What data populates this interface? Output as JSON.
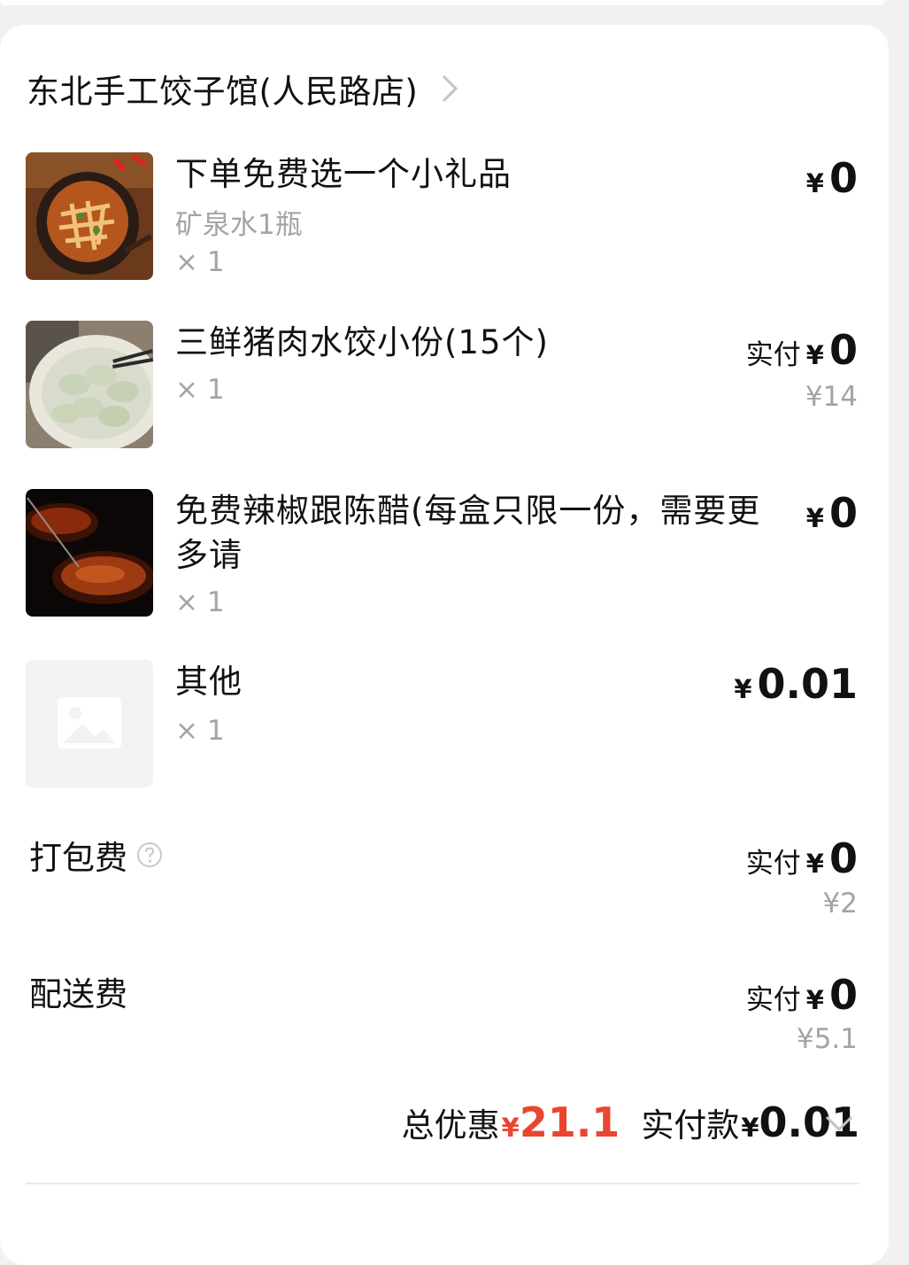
{
  "shop": {
    "name": "东北手工饺子馆(人民路店)"
  },
  "items": [
    {
      "name": "下单免费选一个小礼品",
      "sub": "矿泉水1瓶",
      "qty": "× 1",
      "currency": "¥",
      "price": "0"
    },
    {
      "name": "三鲜猪肉水饺小份(15个)",
      "qty": "× 1",
      "paid_label": "实付",
      "currency": "¥",
      "price": "0",
      "original_price": "¥14"
    },
    {
      "name": "免费辣椒跟陈醋(每盒只限一份，需要更多请",
      "qty": "× 1",
      "currency": "¥",
      "price": "0"
    },
    {
      "name": "其他",
      "qty": "× 1",
      "currency": "¥",
      "price": "0.01"
    }
  ],
  "fees": {
    "packing": {
      "label": "打包费",
      "paid_label": "实付",
      "currency": "¥",
      "price": "0",
      "original_price": "¥2"
    },
    "delivery": {
      "label": "配送费",
      "paid_label": "实付",
      "currency": "¥",
      "price": "0",
      "original_price": "¥5.1"
    }
  },
  "summary": {
    "discount_label": "总优惠",
    "discount_currency": "¥",
    "discount_amount": "21.1",
    "paid_label": "实付款",
    "paid_currency": "¥",
    "paid_amount": "0.01"
  },
  "colors": {
    "accent": "#e9452f",
    "muted": "#a4a4a4",
    "text": "#111111"
  },
  "icons": {
    "shop_chevron": "chevron-right-icon",
    "help": "question-circle-icon",
    "expand": "chevron-down-icon",
    "placeholder": "image-placeholder-icon"
  }
}
